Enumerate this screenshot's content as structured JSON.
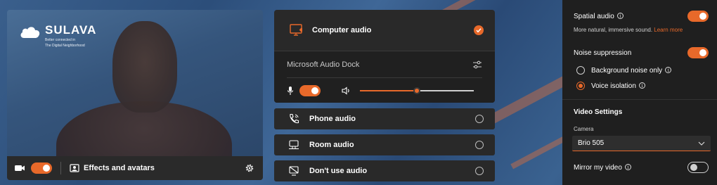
{
  "colors": {
    "accent": "#e8692a",
    "panel": "#292929",
    "panel_dark": "#202020",
    "sidebar": "#1f1f1f"
  },
  "preview": {
    "logo_name": "SULAVA",
    "logo_tagline_1": "Better connected in",
    "logo_tagline_2": "The Digital Neighborhood",
    "camera_on": true,
    "effects_label": "Effects and avatars"
  },
  "audio": {
    "computer_audio": {
      "label": "Computer audio",
      "selected": true
    },
    "device_name": "Microsoft Audio Dock",
    "mic_on": true,
    "volume_percent": 50,
    "options": [
      {
        "label": "Phone audio",
        "icon": "phone-icon"
      },
      {
        "label": "Room audio",
        "icon": "room-icon"
      },
      {
        "label": "Don't use audio",
        "icon": "no-audio-icon"
      }
    ]
  },
  "settings": {
    "spatial_audio": {
      "label": "Spatial audio",
      "on": true,
      "desc": "More natural, immersive sound.",
      "link": "Learn more"
    },
    "noise_suppression": {
      "label": "Noise suppression",
      "on": true
    },
    "noise_options": [
      {
        "label": "Background noise only",
        "selected": false
      },
      {
        "label": "Voice isolation",
        "selected": true
      }
    ],
    "video_title": "Video Settings",
    "camera_label": "Camera",
    "camera_value": "Brio 505",
    "mirror": {
      "label": "Mirror my video",
      "on": false
    }
  }
}
